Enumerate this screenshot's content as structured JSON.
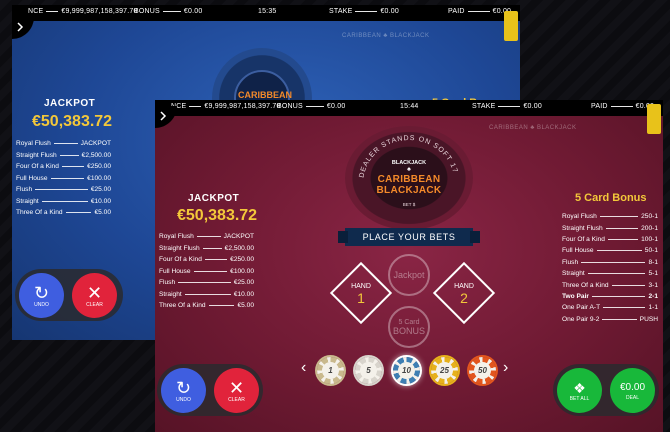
{
  "back_window": {
    "topbar": {
      "balance_label": "NCE",
      "balance_value": "€9,999,987,158,397.70",
      "bonus_label": "BONUS",
      "bonus_value": "€0.00",
      "time": "15:35",
      "stake_label": "STAKE",
      "stake_value": "€0.00",
      "paid_label": "PAID",
      "paid_value": "€0.00"
    },
    "table_brand": "CARIBBEAN ♣ BLACKJACK",
    "jackpot_title": "JACKPOT",
    "jackpot_amount": "€50,383.72",
    "paytable": [
      {
        "hand": "Royal Flush",
        "pay": "JACKPOT"
      },
      {
        "hand": "Straight Flush",
        "pay": "€2,500.00"
      },
      {
        "hand": "Four Of a Kind",
        "pay": "€250.00"
      },
      {
        "hand": "Full House",
        "pay": "€100.00"
      },
      {
        "hand": "Flush",
        "pay": "€25.00"
      },
      {
        "hand": "Straight",
        "pay": "€10.00"
      },
      {
        "hand": "Three Of a Kind",
        "pay": "€5.00"
      }
    ],
    "undo_label": "UNDO",
    "clear_label": "CLEAR",
    "partial_bonus_title": "5 Card Bonus"
  },
  "front_window": {
    "topbar": {
      "balance_label": "NCE",
      "balance_value": "€9,999,987,158,397.70",
      "bonus_label": "BONUS",
      "bonus_value": "€0.00",
      "time": "15:44",
      "stake_label": "STAKE",
      "stake_value": "€0.00",
      "paid_label": "PAID",
      "paid_value": "€0.00"
    },
    "table_brand": "CARIBBEAN ♣ BLACKJACK",
    "logo": {
      "arc_text": "DEALER STANDS ON SOFT 17",
      "small": "BLACKJACK",
      "line1": "CARIBBEAN",
      "line2": "BLACKJACK",
      "bottom": "BET $"
    },
    "banner": "PLACE YOUR BETS",
    "jackpot_title": "JACKPOT",
    "jackpot_amount": "€50,383.72",
    "paytable": [
      {
        "hand": "Royal Flush",
        "pay": "JACKPOT"
      },
      {
        "hand": "Straight Flush",
        "pay": "€2,500.00"
      },
      {
        "hand": "Four Of a Kind",
        "pay": "€250.00"
      },
      {
        "hand": "Full House",
        "pay": "€100.00"
      },
      {
        "hand": "Flush",
        "pay": "€25.00"
      },
      {
        "hand": "Straight",
        "pay": "€10.00"
      },
      {
        "hand": "Three Of a Kind",
        "pay": "€5.00"
      }
    ],
    "bonus_title": "5 Card Bonus",
    "bonus_table": [
      {
        "hand": "Royal Flush",
        "pay": "250-1"
      },
      {
        "hand": "Straight Flush",
        "pay": "200-1"
      },
      {
        "hand": "Four Of a Kind",
        "pay": "100-1"
      },
      {
        "hand": "Full House",
        "pay": "50-1"
      },
      {
        "hand": "Flush",
        "pay": "8-1"
      },
      {
        "hand": "Straight",
        "pay": "5-1"
      },
      {
        "hand": "Three Of a Kind",
        "pay": "3-1"
      },
      {
        "hand": "Two Pair",
        "pay": "2-1"
      },
      {
        "hand": "One Pair A-T",
        "pay": "1-1"
      },
      {
        "hand": "One Pair 9-2",
        "pay": "PUSH"
      }
    ],
    "hand1": {
      "label": "HAND",
      "num": "1"
    },
    "hand2": {
      "label": "HAND",
      "num": "2"
    },
    "jackpot_spot": "Jackpot",
    "bonus_spot_1": "5 Card",
    "bonus_spot_2": "BONUS",
    "chips": [
      {
        "value": "1",
        "color": "#c9b98d"
      },
      {
        "value": "5",
        "color": "#d8d4cc"
      },
      {
        "value": "10",
        "color": "#3e7fb3"
      },
      {
        "value": "25",
        "color": "#e6b11c"
      },
      {
        "value": "50",
        "color": "#e2561e"
      }
    ],
    "undo_label": "UNDO",
    "clear_label": "CLEAR",
    "betall_label": "BET ALL",
    "deal_amount": "€0.00",
    "deal_label": "DEAL"
  }
}
